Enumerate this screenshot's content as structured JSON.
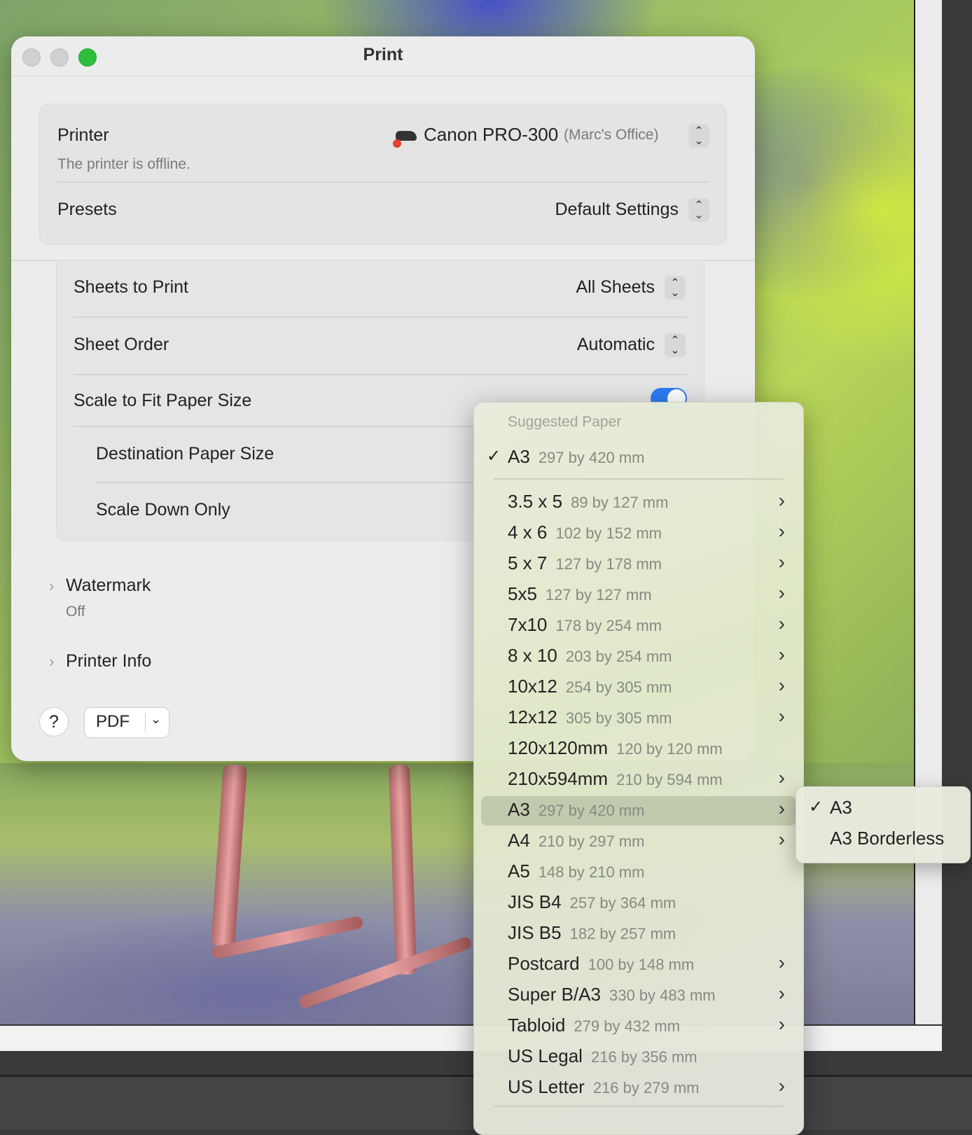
{
  "dialog": {
    "title": "Print",
    "printer": {
      "label": "Printer",
      "status": "The printer is offline.",
      "name": "Canon PRO-300",
      "location": "(Marc's Office)"
    },
    "presets": {
      "label": "Presets",
      "value": "Default Settings"
    },
    "sheets_to_print": {
      "label": "Sheets to Print",
      "value": "All Sheets"
    },
    "sheet_order": {
      "label": "Sheet Order",
      "value": "Automatic"
    },
    "scale_to_fit": {
      "label": "Scale to Fit Paper Size",
      "enabled": true
    },
    "destination_paper_size": {
      "label": "Destination Paper Size"
    },
    "scale_down_only": {
      "label": "Scale Down Only"
    },
    "watermark": {
      "label": "Watermark",
      "value": "Off"
    },
    "printer_info": {
      "label": "Printer Info"
    },
    "help_label": "?",
    "pdf_label": "PDF"
  },
  "paper_menu": {
    "header": "Suggested Paper",
    "suggested": {
      "name": "A3",
      "dims": "297 by 420 mm",
      "checked": true
    },
    "items": [
      {
        "name": "3.5 x 5",
        "dims": "89 by 127 mm",
        "submenu": true
      },
      {
        "name": "4 x 6",
        "dims": "102 by 152 mm",
        "submenu": true
      },
      {
        "name": "5 x 7",
        "dims": "127 by 178 mm",
        "submenu": true
      },
      {
        "name": "5x5",
        "dims": "127 by 127 mm",
        "submenu": true
      },
      {
        "name": "7x10",
        "dims": "178 by 254 mm",
        "submenu": true
      },
      {
        "name": "8 x 10",
        "dims": "203 by 254 mm",
        "submenu": true
      },
      {
        "name": "10x12",
        "dims": "254 by 305 mm",
        "submenu": true
      },
      {
        "name": "12x12",
        "dims": "305 by 305 mm",
        "submenu": true
      },
      {
        "name": "120x120mm",
        "dims": "120 by 120 mm",
        "submenu": false
      },
      {
        "name": "210x594mm",
        "dims": "210 by 594 mm",
        "submenu": true
      },
      {
        "name": "A3",
        "dims": "297 by 420 mm",
        "submenu": true,
        "highlighted": true
      },
      {
        "name": "A4",
        "dims": "210 by 297 mm",
        "submenu": true
      },
      {
        "name": "A5",
        "dims": "148 by 210 mm",
        "submenu": false
      },
      {
        "name": "JIS B4",
        "dims": "257 by 364 mm",
        "submenu": false
      },
      {
        "name": "JIS B5",
        "dims": "182 by 257 mm",
        "submenu": false
      },
      {
        "name": "Postcard",
        "dims": "100 by 148 mm",
        "submenu": true
      },
      {
        "name": "Super B/A3",
        "dims": "330 by 483 mm",
        "submenu": true
      },
      {
        "name": "Tabloid",
        "dims": "279 by 432 mm",
        "submenu": true
      },
      {
        "name": "US Legal",
        "dims": "216 by 356 mm",
        "submenu": false
      },
      {
        "name": "US Letter",
        "dims": "216 by 279 mm",
        "submenu": true
      }
    ]
  },
  "submenu": {
    "items": [
      {
        "name": "A3",
        "checked": true
      },
      {
        "name": "A3 Borderless",
        "checked": false
      }
    ]
  },
  "colors": {
    "accent": "#2c7cf6",
    "close": "#cfcfcf",
    "zoom": "#2dbf3b"
  }
}
